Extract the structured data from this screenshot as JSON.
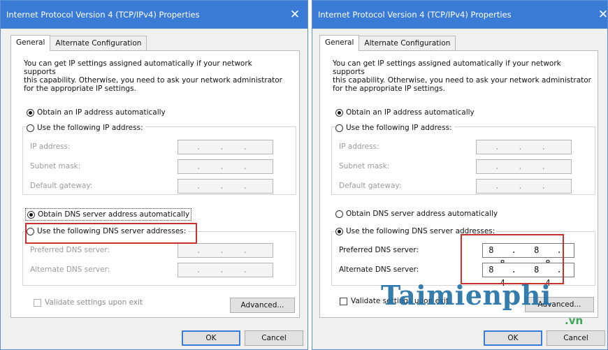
{
  "left": {
    "title": "Internet Protocol Version 4 (TCP/IPv4) Properties",
    "close_glyph": "✕",
    "tabs": [
      "General",
      "Alternate Configuration"
    ],
    "description": "You can get IP settings assigned automatically if your network supports\nthis capability. Otherwise, you need to ask your network administrator\nfor the appropriate IP settings.",
    "ip_auto": "Obtain an IP address automatically",
    "ip_manual": "Use the following IP address:",
    "ip_address_label": "IP address:",
    "subnet_label": "Subnet mask:",
    "gateway_label": "Default gateway:",
    "ip_address_value": ". . .",
    "subnet_value": ". . .",
    "gateway_value": ". . .",
    "dns_auto": "Obtain DNS server address automatically",
    "dns_manual": "Use the following DNS server addresses:",
    "preferred_label": "Preferred DNS server:",
    "alternate_label": "Alternate DNS server:",
    "preferred_value": ". . .",
    "alternate_value": ". . .",
    "validate": "Validate settings upon exit",
    "advanced": "Advanced...",
    "ok": "OK",
    "cancel": "Cancel"
  },
  "right": {
    "title": "Internet Protocol Version 4 (TCP/IPv4) Properties",
    "close_glyph": "✕",
    "tabs": [
      "General",
      "Alternate Configuration"
    ],
    "description": "You can get IP settings assigned automatically if your network supports\nthis capability. Otherwise, you need to ask your network administrator\nfor the appropriate IP settings.",
    "ip_auto": "Obtain an IP address automatically",
    "ip_manual": "Use the following IP address:",
    "ip_address_label": "IP address:",
    "subnet_label": "Subnet mask:",
    "gateway_label": "Default gateway:",
    "ip_address_value": ". . .",
    "subnet_value": ". . .",
    "gateway_value": ". . .",
    "dns_auto": "Obtain DNS server address automatically",
    "dns_manual": "Use the following DNS server addresses:",
    "preferred_label": "Preferred DNS server:",
    "alternate_label": "Alternate DNS server:",
    "preferred_value": "8 . 8 . 8 . 8",
    "alternate_value": "8 . 8 . 4 . 4",
    "validate": "Validate settings upon exit",
    "advanced": "Advanced...",
    "ok": "OK",
    "cancel": "Cancel"
  },
  "watermark": {
    "brand": "Taimienphi",
    "domain": ".vn"
  },
  "colors": {
    "titlebar": "#3a7bd5",
    "highlight_box": "#c8312e",
    "watermark": "#1f6fa5",
    "watermark_domain": "#2e9e48"
  }
}
